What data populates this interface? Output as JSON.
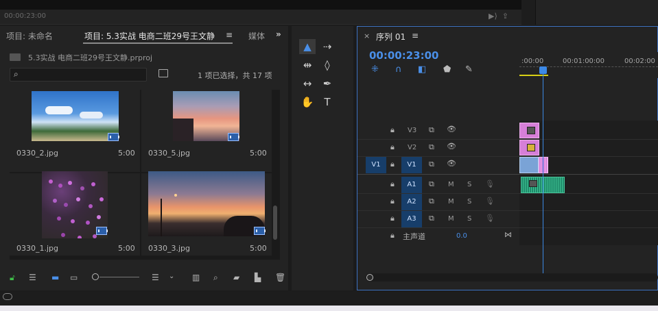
{
  "top_monitor": {
    "timecode": "00:00:23:00"
  },
  "project_panel": {
    "tabs": [
      {
        "label": "项目: 未命名"
      },
      {
        "label": "项目: 5.3实战 电商二班29号王文静"
      },
      {
        "label": "媒体"
      }
    ],
    "path": "5.3实战 电商二班29号王文静.prproj",
    "search": {
      "value": "",
      "placeholder": ""
    },
    "selection_status": "1 项已选择，共 17 项",
    "items": [
      {
        "name": "0330_2.jpg",
        "duration": "5:00"
      },
      {
        "name": "0330_5.jpg",
        "duration": "5:00"
      },
      {
        "name": "0330_1.jpg",
        "duration": "5:00"
      },
      {
        "name": "0330_3.jpg",
        "duration": "5:00"
      }
    ]
  },
  "timeline": {
    "title": "序列 01",
    "timecode": "00:00:23:00",
    "ruler_labels": [
      ":00:00",
      "00:01:00:00",
      "00:02:00"
    ],
    "video_tracks": [
      {
        "name": "V3",
        "source_patch": ""
      },
      {
        "name": "V2",
        "source_patch": ""
      },
      {
        "name": "V1",
        "source_patch": "V1"
      }
    ],
    "audio_tracks": [
      {
        "name": "A1",
        "m": "M",
        "s": "S"
      },
      {
        "name": "A2",
        "m": "M",
        "s": "S"
      },
      {
        "name": "A3",
        "m": "M",
        "s": "S"
      }
    ],
    "master": {
      "label": "主声道",
      "value": "0.0"
    }
  },
  "colors": {
    "accent": "#3c89e6",
    "video_clip": "#d67fd8",
    "audio_clip": "#1f8a6a",
    "work_area": "#d8d015"
  }
}
